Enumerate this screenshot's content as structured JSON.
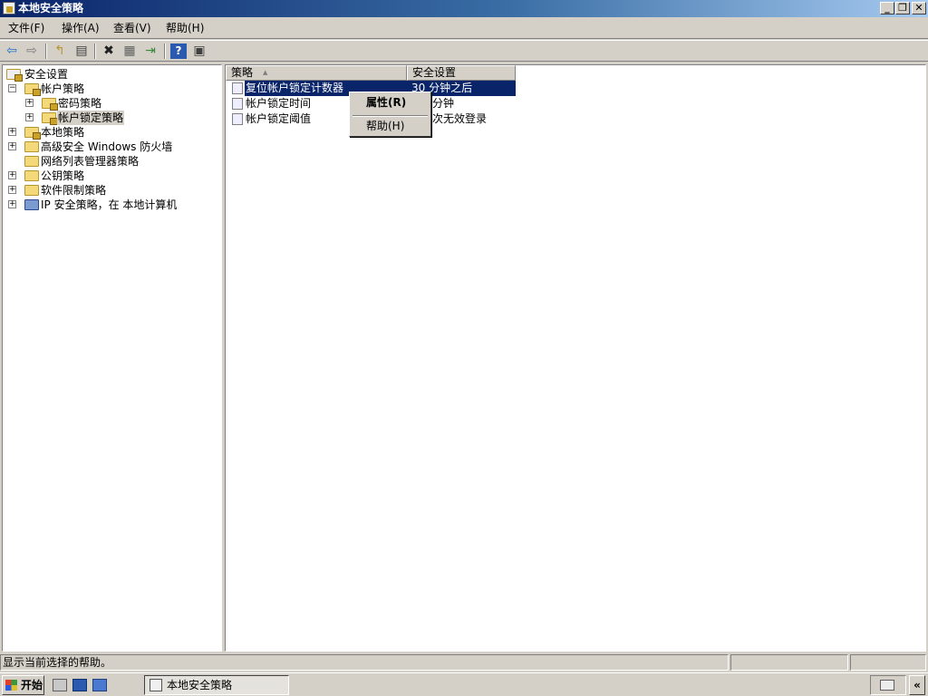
{
  "window": {
    "title": "本地安全策略"
  },
  "menu": [
    {
      "label": "文件(F)"
    },
    {
      "label": "操作(A)"
    },
    {
      "label": "查看(V)"
    },
    {
      "label": "帮助(H)"
    }
  ],
  "toolbar": {
    "buttons": [
      "back-arrow-icon",
      "forward-arrow-icon",
      "up-folder-icon",
      "show-hide-tree-icon",
      "delete-icon",
      "properties-icon",
      "export-list-icon",
      "help-icon",
      "console-icon"
    ],
    "glyphs": {
      "back": "⇦",
      "forward": "⇨",
      "up": "↰",
      "tree": "▤",
      "delete": "✖",
      "props": "▦",
      "export": "⇥",
      "help": "?",
      "console": "▣"
    }
  },
  "tree": {
    "root": "安全设置",
    "nodes": [
      {
        "label": "帐户策略",
        "expander": "−"
      },
      {
        "label": "密码策略",
        "expander": "+"
      },
      {
        "label": "帐户锁定策略",
        "expander": "+"
      },
      {
        "label": "本地策略",
        "expander": "+"
      },
      {
        "label": "高级安全 Windows 防火墙",
        "expander": "+"
      },
      {
        "label": "网络列表管理器策略",
        "expander": ""
      },
      {
        "label": "公钥策略",
        "expander": "+"
      },
      {
        "label": "软件限制策略",
        "expander": "+"
      },
      {
        "label": "IP 安全策略，在 本地计算机",
        "expander": "+"
      }
    ]
  },
  "list": {
    "columns": [
      "策略",
      "安全设置"
    ],
    "sort_indicator": "▲",
    "rows": [
      {
        "policy": "复位帐户锁定计数器",
        "setting": "30 分钟之后"
      },
      {
        "policy": "帐户锁定时间",
        "setting": "分钟"
      },
      {
        "policy": "帐户锁定阈值",
        "setting": "次无效登录"
      }
    ]
  },
  "context_menu": {
    "items": [
      {
        "label": "属性(R)"
      },
      {
        "label": "帮助(H)"
      }
    ]
  },
  "status": {
    "text": "显示当前选择的帮助。"
  },
  "taskbar": {
    "start_label": "开始",
    "task_label": "本地安全策略",
    "chevron": "«"
  },
  "window_buttons": {
    "minimize": "_",
    "restore": "❐",
    "close": "✕"
  }
}
